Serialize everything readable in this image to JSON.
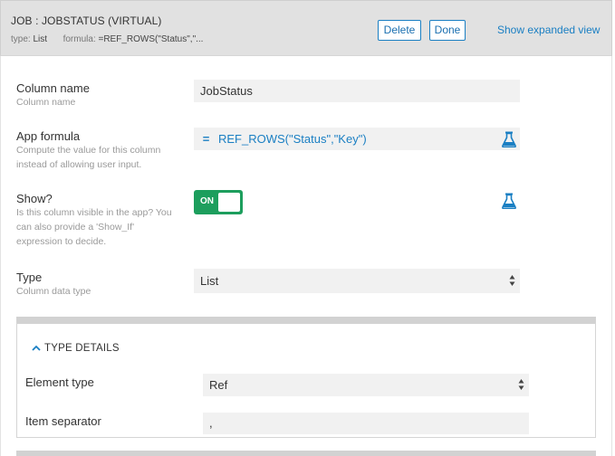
{
  "header": {
    "title": "JOB : JOBSTATUS (VIRTUAL)",
    "type_label": "type:",
    "type_value": "List",
    "formula_label": "formula:",
    "formula_value": "=REF_ROWS(\"Status\",\"...",
    "delete_label": "Delete",
    "done_label": "Done",
    "expanded_link": "Show expanded view"
  },
  "column_name": {
    "label": "Column name",
    "hint": "Column name",
    "value": "JobStatus"
  },
  "app_formula": {
    "label": "App formula",
    "hint_line1": "Compute the value for this column",
    "hint_line2": "instead of allowing user input.",
    "eq": "=",
    "value": "REF_ROWS(\"Status\",\"Key\")"
  },
  "show": {
    "label": "Show?",
    "hint_line1": "Is this column visible in the app? You",
    "hint_line2": "can also provide a 'Show_If'",
    "hint_line3": "expression to decide.",
    "toggle_label": "ON"
  },
  "type": {
    "label": "Type",
    "hint": "Column data type",
    "value": "List"
  },
  "type_details": {
    "header": "TYPE DETAILS",
    "element_type_label": "Element type",
    "element_type_value": "Ref",
    "item_separator_label": "Item separator",
    "item_separator_value": ","
  },
  "colors": {
    "accent": "#1a7fc3",
    "toggle_on": "#1d9e5d",
    "header_bg": "#e1e1e1"
  },
  "icons": {
    "flask": "flask-icon",
    "chevron": "chevron-up-icon",
    "select": "select-arrows-icon"
  }
}
